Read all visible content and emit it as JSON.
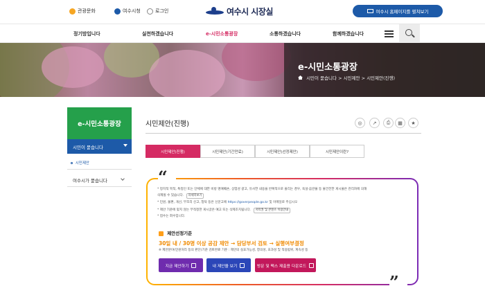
{
  "header": {
    "util_links": [
      "관광문화",
      "여수시청",
      "로그인"
    ],
    "logo_text": "여수시 시장실",
    "top_button": "여수시 홈페이지를 펼쳐보기"
  },
  "gnb": {
    "items": [
      "정기방입니다",
      "실천하겠습니다",
      "e-시민소통광장",
      "소통하겠습니다",
      "함께하겠습니다"
    ],
    "active_index": 2
  },
  "hero": {
    "title": "e-시민소통광장",
    "breadcrumb": "시민이 묻습니다 > 시민제안 > 시민제안(진행)"
  },
  "sidebar": {
    "title": "e-시민소통광장",
    "active_item": "시민이 묻습니다",
    "sub_item": "시민제안",
    "item2": "여수시가 묻습니다"
  },
  "content": {
    "title": "시민제안(진행)",
    "tools": [
      "copy-icon",
      "share-icon",
      "print-icon",
      "bookmark-icon",
      "star-icon"
    ]
  },
  "tabs": [
    "시민제안(진행)",
    "시민제안(기간만료)",
    "시민제안(선정제안)",
    "시민제안이란?"
  ],
  "notice": {
    "lines": [
      "* 정치적 목적, 특정인 또는 단체에 대한 비방 명예훼손, 상업성 광고, 유사한 내용을 반복적으로 올리는 경우, 욕설·음란물 등 불건전한 게시물은 관리자에 의해",
      "   삭제될 수 있습니다.",
      "* 민원, 불편, 개선, 부조리 신고, 청탁 등은 신문고에",
      "* 제안 기준에 맞지 않는 부적정한 게시글은 예고 또는 삭제조치됩니다.",
      "* 접수는 회수입니다."
    ],
    "pill_1": "자세히보기",
    "url": "https://goverpeople.go.kr",
    "url_tail": "및 이메일로 주십시오",
    "pill_2": "저작권 및 콘텐츠 이용안내"
  },
  "criteria": {
    "title": "제안선정기준",
    "highlight": "30일 내 / 30명 이상 공감 제안 → 담당부서 검토 → 실행여부결정",
    "sub": "※ 제안분야(민원처리 등의 판단)기준 검토완료 기준 : 제안의 실효가능성, 창의성, 효과성 및 적용범위, 계속성 등"
  },
  "actions": [
    {
      "label": "지금 제안하기",
      "color": "#6f2cae"
    },
    {
      "label": "내 제안을 보기",
      "color": "#2b46b8"
    },
    {
      "label": "방문 및 팩스 제출용 다운로드",
      "color": "#c2185b"
    }
  ]
}
